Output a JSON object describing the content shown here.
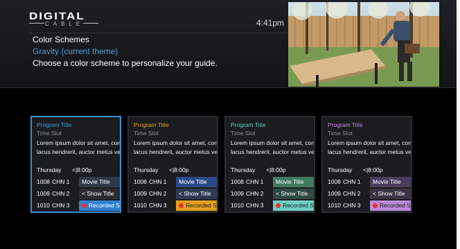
{
  "header": {
    "logo_main": "DIGITAL",
    "logo_sub": "CABLE",
    "time": "4:41pm",
    "title": "Color Schemes",
    "current_theme": "Gravity (current theme)",
    "instruction": "Choose a color scheme to personalize your guide."
  },
  "cards": [
    {
      "program_title": "Program Title",
      "time_slot": "Time Slot",
      "desc_line1": "Lorem ipsum dolor sit amet, con",
      "desc_line2": "lacus hendrerit, auctor metus ve",
      "day": "Thursday",
      "time": "<|8:00p",
      "rows": [
        {
          "num": "1008",
          "chn": "CHN 1",
          "prog": "Movie Title"
        },
        {
          "num": "1009",
          "chn": "CHN 2",
          "prog": "< Show Title"
        },
        {
          "num": "1010",
          "chn": "CHN 3",
          "prog": "Recorded Sh"
        }
      ],
      "colors": {
        "title": "#3d9ad9",
        "movie_bg": "#2f3a4a",
        "show_bg": "#2a2c31",
        "rec_bg": "#2f7fd0"
      }
    },
    {
      "program_title": "Program Title",
      "time_slot": "Time Slot",
      "desc_line1": "Lorem ipsum dolor sit amet, con",
      "desc_line2": "lacus hendrerit, auctor metus ve",
      "day": "Thursday",
      "time": "<|8:00p",
      "rows": [
        {
          "num": "1008",
          "chn": "CHN 1",
          "prog": "Movie Title"
        },
        {
          "num": "1009",
          "chn": "CHN 2",
          "prog": "< Show Title"
        },
        {
          "num": "1010",
          "chn": "CHN 3",
          "prog": "Recorded Sh"
        }
      ],
      "colors": {
        "title": "#e8a21f",
        "movie_bg": "#2d4a88",
        "show_bg": "#2f3b55",
        "rec_bg": "#e3a020"
      }
    },
    {
      "program_title": "Program Title",
      "time_slot": "Time Slot",
      "desc_line1": "Lorem ipsum dolor sit amet, con",
      "desc_line2": "lacus hendrerit, auctor metus ve",
      "day": "Thursday",
      "time": "<|8:00p",
      "rows": [
        {
          "num": "1008",
          "chn": "CHN 1",
          "prog": "Movie Title"
        },
        {
          "num": "1009",
          "chn": "CHN 2",
          "prog": "< Show Title"
        },
        {
          "num": "1010",
          "chn": "CHN 3",
          "prog": "Recorded Sh"
        }
      ],
      "colors": {
        "title": "#5fd0c4",
        "movie_bg": "#3f7a5f",
        "show_bg": "#2f4a42",
        "rec_bg": "#6fcfc7"
      }
    },
    {
      "program_title": "Program Title",
      "time_slot": "Time Slot",
      "desc_line1": "Lorem ipsum dolor sit amet, con",
      "desc_line2": "lacus hendrerit, auctor metus ve",
      "day": "Thursday",
      "time": "<|8:00p",
      "rows": [
        {
          "num": "1008",
          "chn": "CHN 1",
          "prog": "Movie Title"
        },
        {
          "num": "1009",
          "chn": "CHN 2",
          "prog": "< Show Title"
        },
        {
          "num": "1010",
          "chn": "CHN 3",
          "prog": "Recorded Sh"
        }
      ],
      "colors": {
        "title": "#c58ae0",
        "movie_bg": "#4a3d5c",
        "show_bg": "#3a3344",
        "rec_bg": "#b98ad6"
      }
    }
  ],
  "selected_card": 0,
  "colors": {
    "background": "#000000",
    "header_bg": "#1a1c20",
    "accent": "#4f9fd8",
    "record_dot": "#e8332c"
  }
}
